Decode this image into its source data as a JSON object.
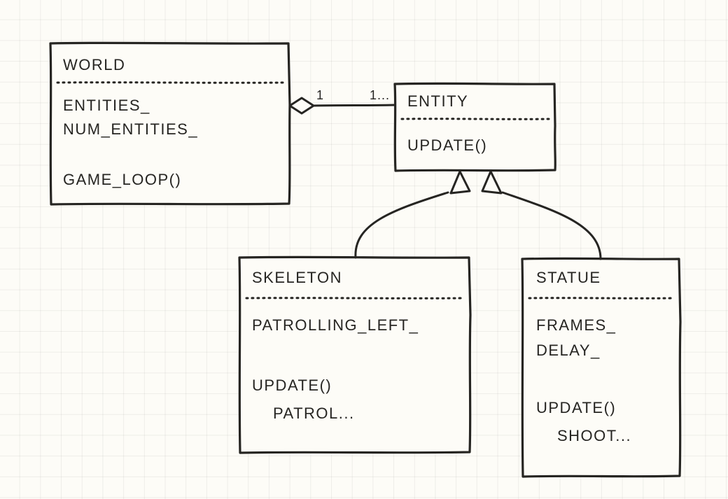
{
  "diagram": {
    "type": "uml_class",
    "classes": {
      "world": {
        "name": "WORLD",
        "attributes": [
          "ENTITIES_",
          "NUM_ENTITIES_"
        ],
        "methods": [
          "GAME_LOOP()"
        ]
      },
      "entity": {
        "name": "ENTITY",
        "attributes": [],
        "methods": [
          "UPDATE()"
        ]
      },
      "skeleton": {
        "name": "SKELETON",
        "attributes": [
          "PATROLLING_LEFT_"
        ],
        "methods": [
          "UPDATE()",
          "PATROL..."
        ]
      },
      "statue": {
        "name": "STATUE",
        "attributes": [
          "FRAMES_",
          "DELAY_"
        ],
        "methods": [
          "UPDATE()",
          "SHOOT..."
        ]
      }
    },
    "relationships": [
      {
        "type": "aggregation",
        "from": "world",
        "to": "entity",
        "from_multiplicity": "1",
        "to_multiplicity": "1..."
      },
      {
        "type": "inheritance",
        "child": "skeleton",
        "parent": "entity"
      },
      {
        "type": "inheritance",
        "child": "statue",
        "parent": "entity"
      }
    ]
  }
}
